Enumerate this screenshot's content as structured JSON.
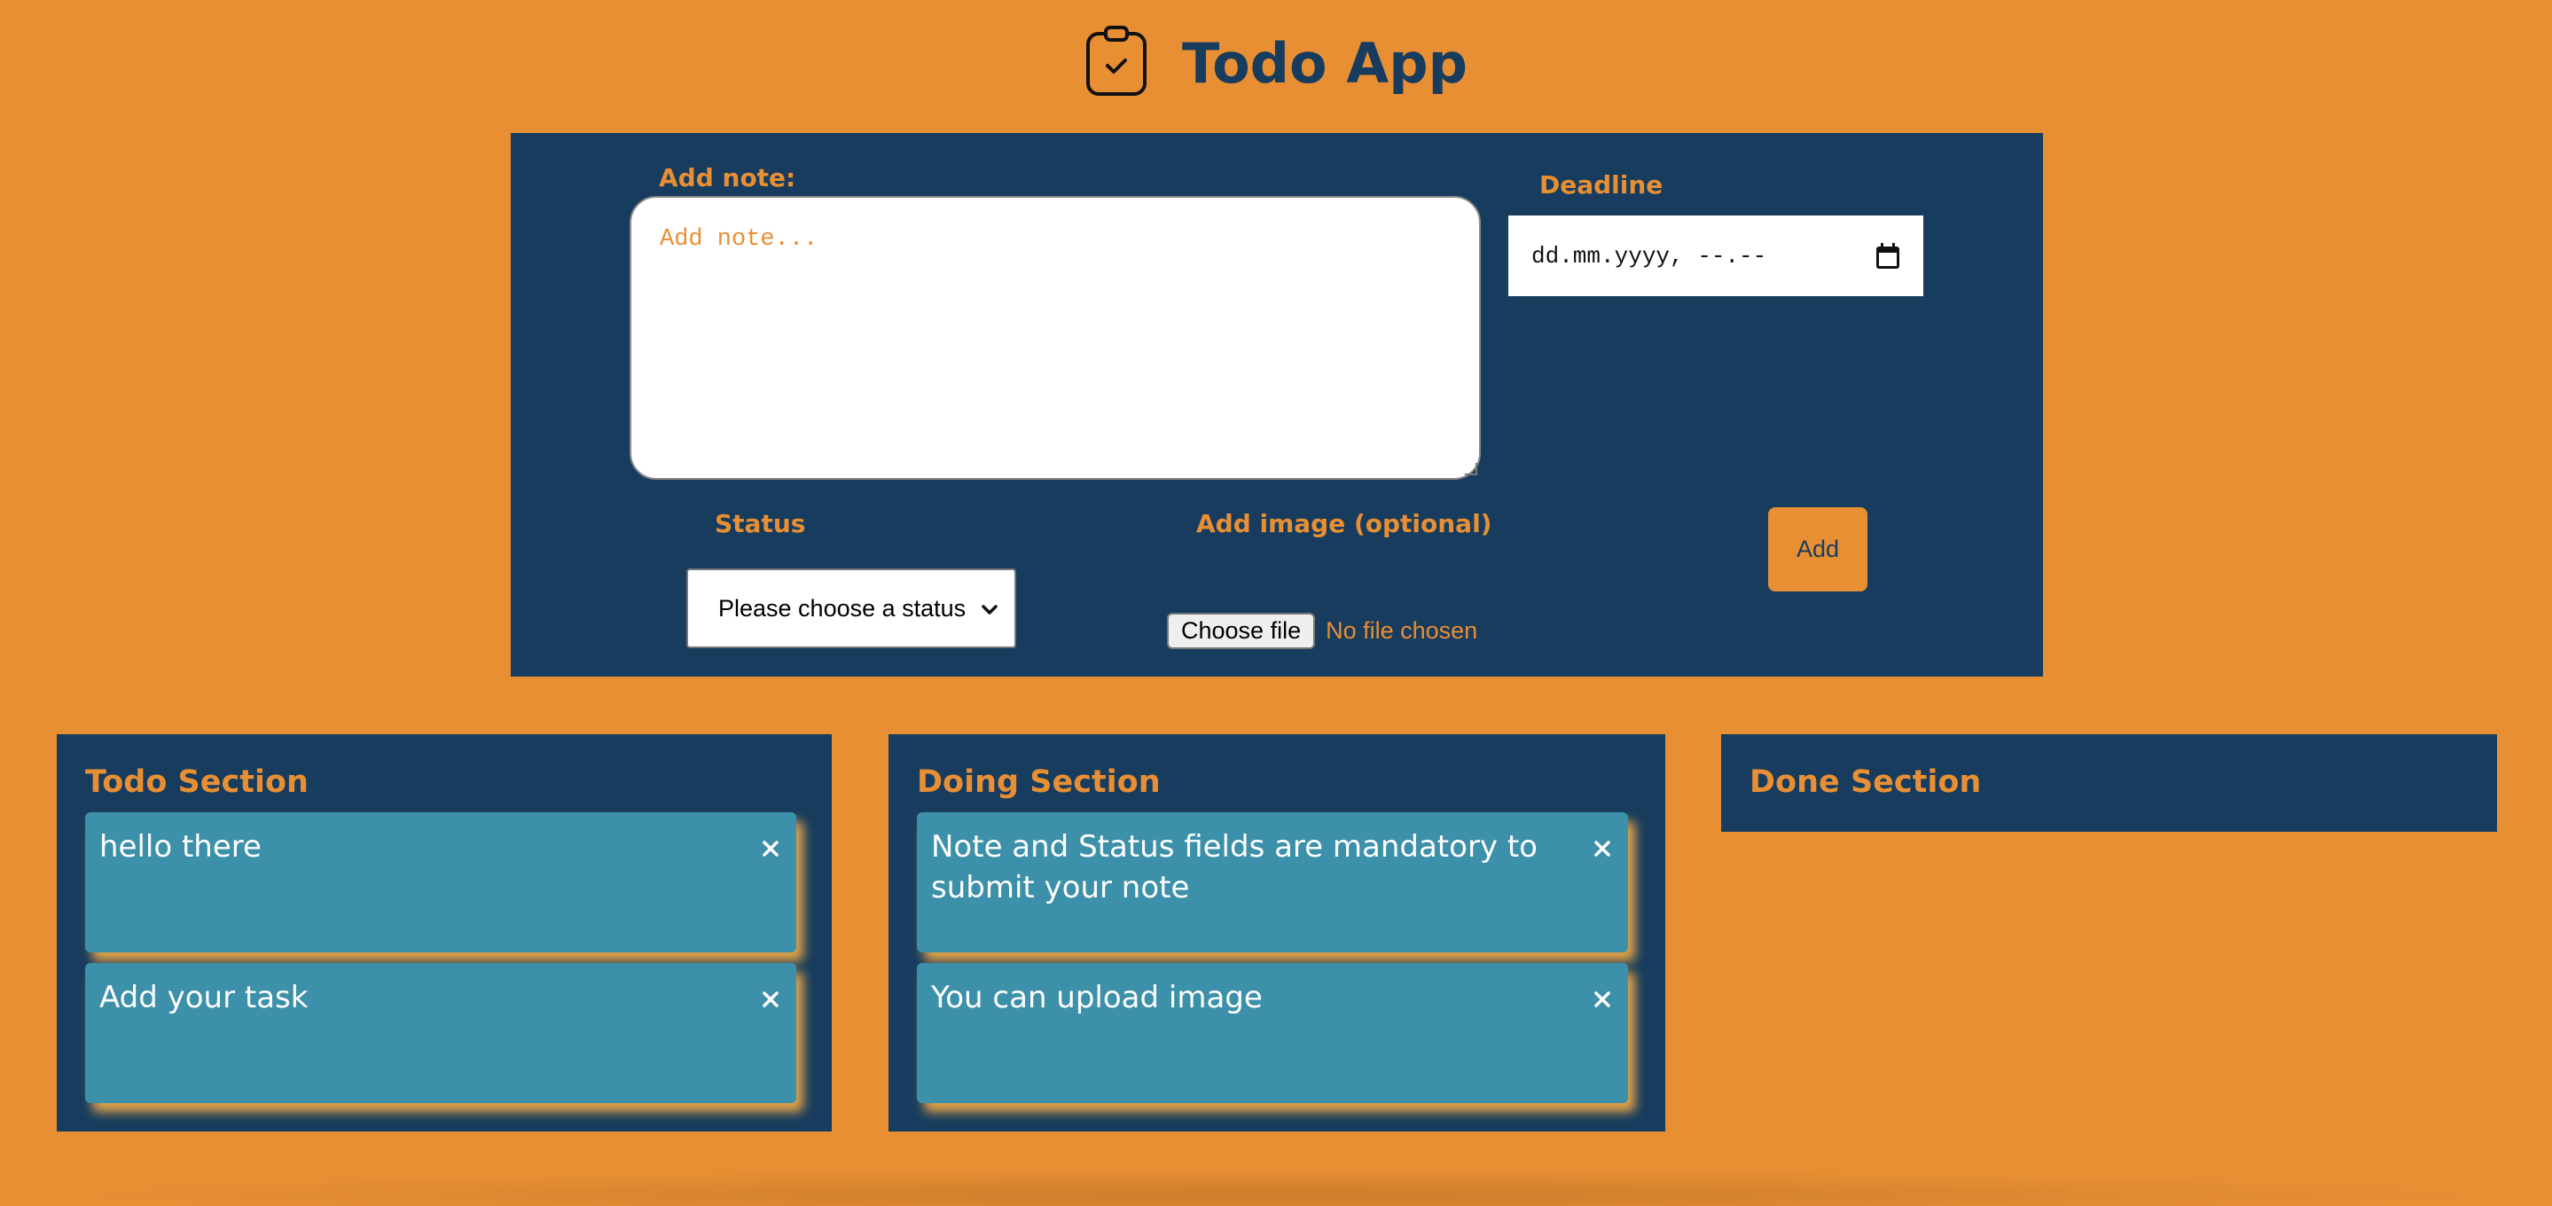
{
  "app": {
    "title": "Todo App"
  },
  "form": {
    "note_label": "Add note:",
    "note_placeholder": "Add note...",
    "deadline_label": "Deadline",
    "deadline_value": "dd.mm.yyyy, --.--",
    "status_label": "Status",
    "status_selected": "Please choose a status",
    "image_label": "Add image (optional)",
    "choose_file_label": "Choose file",
    "no_file_text": "No file chosen",
    "add_label": "Add"
  },
  "sections": {
    "todo": {
      "title": "Todo Section",
      "cards": [
        {
          "text": "hello there"
        },
        {
          "text": "Add your task"
        }
      ]
    },
    "doing": {
      "title": "Doing Section",
      "cards": [
        {
          "text": "Note and Status fields are mandatory to submit your note"
        },
        {
          "text": "You can upload image"
        }
      ]
    },
    "done": {
      "title": "Done Section",
      "cards": []
    }
  },
  "icons": {
    "logo": "clipboard-check-icon",
    "calendar": "calendar-icon",
    "dropdown": "chevron-down-icon",
    "close": "close-icon"
  },
  "colors": {
    "background": "#E88F34",
    "panel": "#173C5E",
    "card": "#3C90A9",
    "accent": "#E88F34"
  }
}
